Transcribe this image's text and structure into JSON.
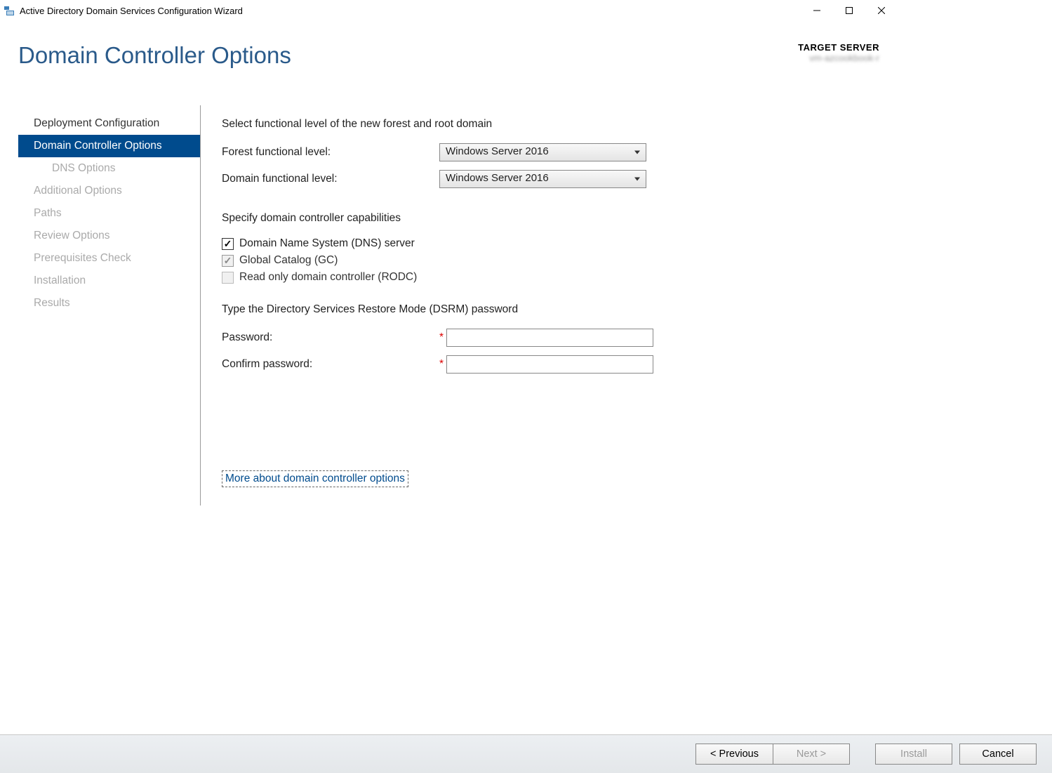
{
  "window": {
    "title": "Active Directory Domain Services Configuration Wizard"
  },
  "header": {
    "title": "Domain Controller Options",
    "target_label": "TARGET SERVER",
    "target_value": "vm-azcookbook-r"
  },
  "sidebar": {
    "steps": [
      {
        "label": "Deployment Configuration",
        "state": "done",
        "indent": false
      },
      {
        "label": "Domain Controller Options",
        "state": "active",
        "indent": false
      },
      {
        "label": "DNS Options",
        "state": "pending",
        "indent": true
      },
      {
        "label": "Additional Options",
        "state": "pending",
        "indent": false
      },
      {
        "label": "Paths",
        "state": "pending",
        "indent": false
      },
      {
        "label": "Review Options",
        "state": "pending",
        "indent": false
      },
      {
        "label": "Prerequisites Check",
        "state": "pending",
        "indent": false
      },
      {
        "label": "Installation",
        "state": "pending",
        "indent": false
      },
      {
        "label": "Results",
        "state": "pending",
        "indent": false
      }
    ]
  },
  "content": {
    "functional_heading": "Select functional level of the new forest and root domain",
    "forest_label": "Forest functional level:",
    "forest_value": "Windows Server 2016",
    "domain_label": "Domain functional level:",
    "domain_value": "Windows Server 2016",
    "caps_heading": "Specify domain controller capabilities",
    "cb_dns": "Domain Name System (DNS) server",
    "cb_gc": "Global Catalog (GC)",
    "cb_rodc": "Read only domain controller (RODC)",
    "dsrm_heading": "Type the Directory Services Restore Mode (DSRM) password",
    "pwd_label": "Password:",
    "cpwd_label": "Confirm password:",
    "more_link": "More about domain controller options"
  },
  "footer": {
    "previous": "< Previous",
    "next": "Next >",
    "install": "Install",
    "cancel": "Cancel"
  }
}
